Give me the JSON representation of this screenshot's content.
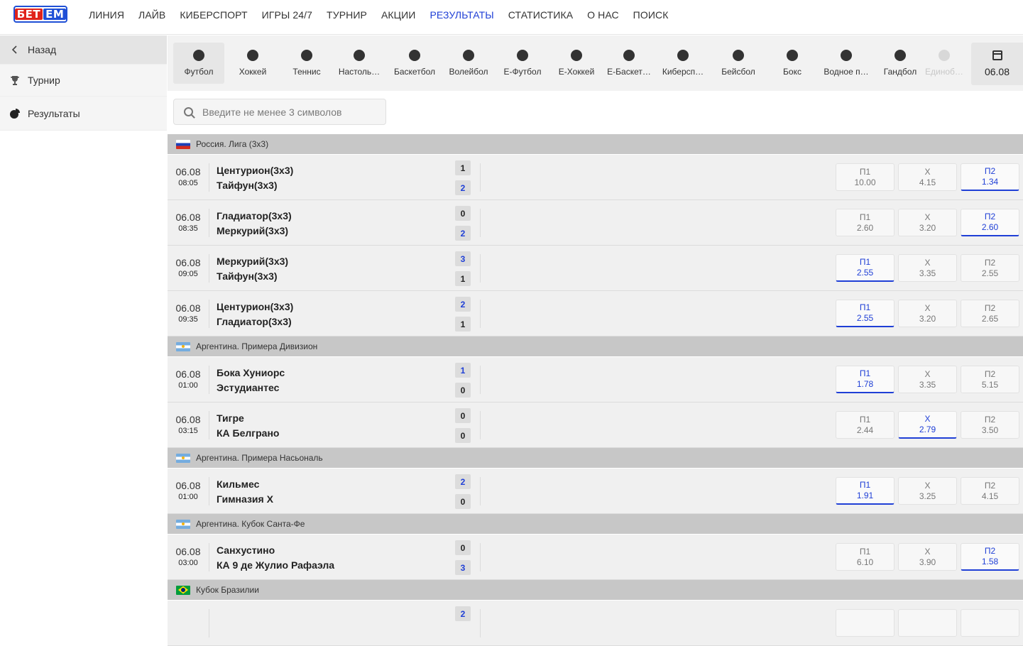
{
  "brand": {
    "logo_a": "БЕТ",
    "logo_b": "ЕМ"
  },
  "nav": [
    "ЛИНИЯ",
    "ЛАЙВ",
    "КИБЕРСПОРТ",
    "ИГРЫ 24/7",
    "ТУРНИР",
    "АКЦИИ",
    "РЕЗУЛЬТАТЫ",
    "СТАТИСТИКА",
    "О НАС",
    "ПОИСК"
  ],
  "nav_active": "РЕЗУЛЬТАТЫ",
  "sidebar": {
    "back": "Назад",
    "tournament": "Турнир",
    "results": "Результаты"
  },
  "sports": [
    "Футбол",
    "Хоккей",
    "Теннис",
    "Настоль…",
    "Баскетбол",
    "Волейбол",
    "E-Футбол",
    "E-Хоккей",
    "E-Баскет…",
    "Киберсп…",
    "Бейсбол",
    "Бокс",
    "Водное п…",
    "Гандбол",
    "Единоб…"
  ],
  "date_filter": "06.08",
  "search": {
    "placeholder": "Введите не менее 3 символов"
  },
  "colors": {
    "accent": "#1f3fd6",
    "league_bar": "#c7c7c7",
    "row_bg": "#f0f0f0"
  },
  "odds_labels": {
    "p1": "П1",
    "x": "Х",
    "p2": "П2"
  },
  "leagues": [
    {
      "name": "Россия. Лига (3х3)",
      "flag": "ru",
      "matches": [
        {
          "date": "06.08",
          "time": "08:05",
          "home": "Центурион(3х3)",
          "away": "Тайфун(3х3)",
          "score_home": "1",
          "score_away": "2",
          "p1": "10.00",
          "x": "4.15",
          "p2": "1.34",
          "win": "p2"
        },
        {
          "date": "06.08",
          "time": "08:35",
          "home": "Гладиатор(3х3)",
          "away": "Меркурий(3х3)",
          "score_home": "0",
          "score_away": "2",
          "p1": "2.60",
          "x": "3.20",
          "p2": "2.60",
          "win": "p2"
        },
        {
          "date": "06.08",
          "time": "09:05",
          "home": "Меркурий(3х3)",
          "away": "Тайфун(3х3)",
          "score_home": "3",
          "score_away": "1",
          "p1": "2.55",
          "x": "3.35",
          "p2": "2.55",
          "win": "p1"
        },
        {
          "date": "06.08",
          "time": "09:35",
          "home": "Центурион(3х3)",
          "away": "Гладиатор(3х3)",
          "score_home": "2",
          "score_away": "1",
          "p1": "2.55",
          "x": "3.20",
          "p2": "2.65",
          "win": "p1"
        }
      ]
    },
    {
      "name": "Аргентина. Примера Дивизион",
      "flag": "ar",
      "matches": [
        {
          "date": "06.08",
          "time": "01:00",
          "home": "Бока Хуниорс",
          "away": "Эстудиантес",
          "score_home": "1",
          "score_away": "0",
          "p1": "1.78",
          "x": "3.35",
          "p2": "5.15",
          "win": "p1"
        },
        {
          "date": "06.08",
          "time": "03:15",
          "home": "Тигре",
          "away": "КА Белграно",
          "score_home": "0",
          "score_away": "0",
          "p1": "2.44",
          "x": "2.79",
          "p2": "3.50",
          "win": "x"
        }
      ]
    },
    {
      "name": "Аргентина. Примера Насьональ",
      "flag": "ar",
      "matches": [
        {
          "date": "06.08",
          "time": "01:00",
          "home": "Кильмес",
          "away": "Гимназия Х",
          "score_home": "2",
          "score_away": "0",
          "p1": "1.91",
          "x": "3.25",
          "p2": "4.15",
          "win": "p1"
        }
      ]
    },
    {
      "name": "Аргентина. Кубок Санта-Фе",
      "flag": "ar",
      "matches": [
        {
          "date": "06.08",
          "time": "03:00",
          "home": "Санхустино",
          "away": "КА 9 де Жулио Рафаэла",
          "score_home": "0",
          "score_away": "3",
          "p1": "6.10",
          "x": "3.90",
          "p2": "1.58",
          "win": "p2"
        }
      ]
    },
    {
      "name": "Кубок Бразилии",
      "flag": "br",
      "matches": [
        {
          "date": "",
          "time": "",
          "home": "",
          "away": "",
          "score_home": "2",
          "score_away": "",
          "p1": "",
          "x": "",
          "p2": "",
          "win": "",
          "partial": true
        }
      ]
    }
  ]
}
